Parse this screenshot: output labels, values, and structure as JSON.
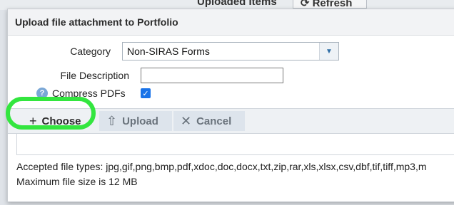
{
  "background": {
    "uploaded_items_label": "Uploaded Items",
    "refresh_label": "Refresh"
  },
  "dialog": {
    "title": "Upload file attachment to Portfolio",
    "category": {
      "label": "Category",
      "value": "Non-SIRAS Forms"
    },
    "file_description": {
      "label": "File Description",
      "value": ""
    },
    "compress_pdfs": {
      "label": "Compress PDFs",
      "checked": true
    },
    "toolbar": {
      "choose_label": "Choose",
      "upload_label": "Upload",
      "cancel_label": "Cancel"
    },
    "accepted_types_text": "Accepted file types: jpg,gif,png,bmp,pdf,xdoc,doc,docx,txt,zip,rar,xls,xlsx,csv,dbf,tif,tiff,mp3,m",
    "max_size_text": "Maximum file size is 12 MB"
  },
  "colors": {
    "highlight_ring": "#33e63f",
    "checkbox_blue": "#1a73e8",
    "help_icon": "#7aa7d6"
  }
}
